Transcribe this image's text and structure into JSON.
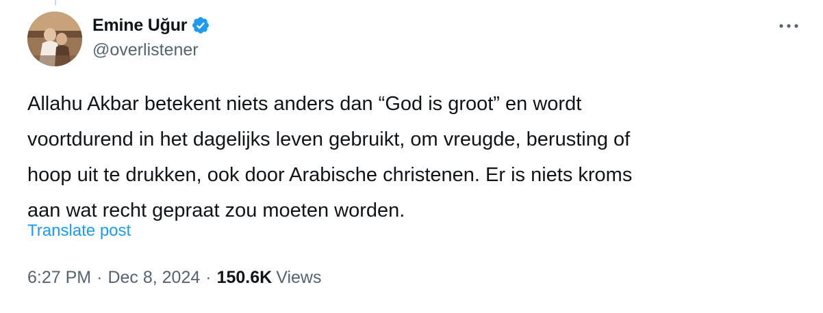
{
  "tweet": {
    "author": {
      "display_name": "Emine Uğur",
      "handle": "@overlistener",
      "verified": true,
      "verified_icon": "verified-badge-icon",
      "avatar_icon": "profile-photo"
    },
    "more_icon": "more-horizontal-icon",
    "text": "Allahu Akbar betekent niets anders dan “God is groot” en wordt\nvoortdurend in het dagelijks leven gebruikt, om vreugde, berusting of\nhoop uit te drukken, ook door Arabische christenen. Er is niets kroms\naan wat recht gepraat zou moeten worden.",
    "translate_label": "Translate post",
    "time": "6:27 PM",
    "separator": "·",
    "date": "Dec 8, 2024",
    "views_count": "150.6K",
    "views_label": "Views"
  },
  "colors": {
    "text_primary": "#0f1419",
    "text_secondary": "#536471",
    "accent": "#1d9bf0"
  }
}
